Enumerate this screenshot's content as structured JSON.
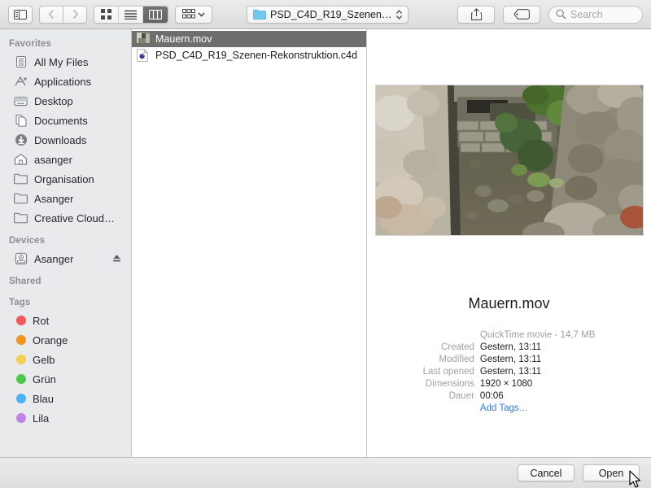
{
  "toolbar": {
    "sidebar_toggle_icon": "sidebar-toggle-icon",
    "back_icon": "chevron-left-icon",
    "forward_icon": "chevron-right-icon",
    "view_modes": [
      {
        "icon": "icon-view-icon",
        "active": false
      },
      {
        "icon": "list-view-icon",
        "active": false
      },
      {
        "icon": "column-view-icon",
        "active": true
      }
    ],
    "arrange_icon": "arrange-grid-icon",
    "arrange_chevron_icon": "chevron-down-icon",
    "path_popup": {
      "folder_icon": "folder-icon",
      "label": "PSD_C4D_R19_Szenen…",
      "stepper_icon": "up-down-chevron-icon"
    },
    "share_icon": "share-icon",
    "tag_icon": "tag-icon",
    "search": {
      "icon": "search-icon",
      "placeholder": "Search",
      "value": ""
    }
  },
  "sidebar": {
    "sections": [
      {
        "title": "Favorites",
        "items": [
          {
            "label": "All My Files",
            "icon": "all-my-files-icon"
          },
          {
            "label": "Applications",
            "icon": "applications-icon"
          },
          {
            "label": "Desktop",
            "icon": "desktop-icon"
          },
          {
            "label": "Documents",
            "icon": "documents-icon"
          },
          {
            "label": "Downloads",
            "icon": "downloads-icon"
          },
          {
            "label": "asanger",
            "icon": "home-icon"
          },
          {
            "label": "Organisation",
            "icon": "folder-icon"
          },
          {
            "label": "Asanger",
            "icon": "folder-icon"
          },
          {
            "label": "Creative Cloud…",
            "icon": "folder-icon"
          }
        ]
      },
      {
        "title": "Devices",
        "items": [
          {
            "label": "Asanger",
            "icon": "harddisk-icon",
            "eject_icon": "eject-icon"
          }
        ]
      },
      {
        "title": "Shared",
        "items": []
      },
      {
        "title": "Tags",
        "items": [
          {
            "label": "Rot",
            "icon": "tag-dot-icon",
            "color": "#f5565a"
          },
          {
            "label": "Orange",
            "icon": "tag-dot-icon",
            "color": "#f7941e"
          },
          {
            "label": "Gelb",
            "icon": "tag-dot-icon",
            "color": "#f8ce51"
          },
          {
            "label": "Grün",
            "icon": "tag-dot-icon",
            "color": "#4cc84c"
          },
          {
            "label": "Blau",
            "icon": "tag-dot-icon",
            "color": "#4eb0f5"
          },
          {
            "label": "Lila",
            "icon": "tag-dot-icon",
            "color": "#c183e8"
          }
        ]
      }
    ]
  },
  "file_list": {
    "items": [
      {
        "name": "Mauern.mov",
        "icon": "movie-thumbnail-icon",
        "selected": true
      },
      {
        "name": "PSD_C4D_R19_Szenen-Rekonstruktion.c4d",
        "icon": "c4d-document-icon",
        "selected": false
      }
    ]
  },
  "preview": {
    "image_alt": "stone-wall-excavation-photo",
    "title": "Mauern.mov",
    "kind_and_size": "QuickTime movie - 14,7 MB",
    "metadata": [
      {
        "key": "Created",
        "value": "Gestern, 13:11"
      },
      {
        "key": "Modified",
        "value": "Gestern, 13:11"
      },
      {
        "key": "Last opened",
        "value": "Gestern, 13:11"
      },
      {
        "key": "Dimensions",
        "value": "1920 × 1080"
      },
      {
        "key": "Dauer",
        "value": "00:06"
      }
    ],
    "add_tags_label": "Add Tags…"
  },
  "footer": {
    "cancel_label": "Cancel",
    "open_label": "Open"
  },
  "colors": {
    "selection": "#6e6e6e",
    "link": "#3679e0",
    "sidebar_bg": "#e8eaec"
  }
}
